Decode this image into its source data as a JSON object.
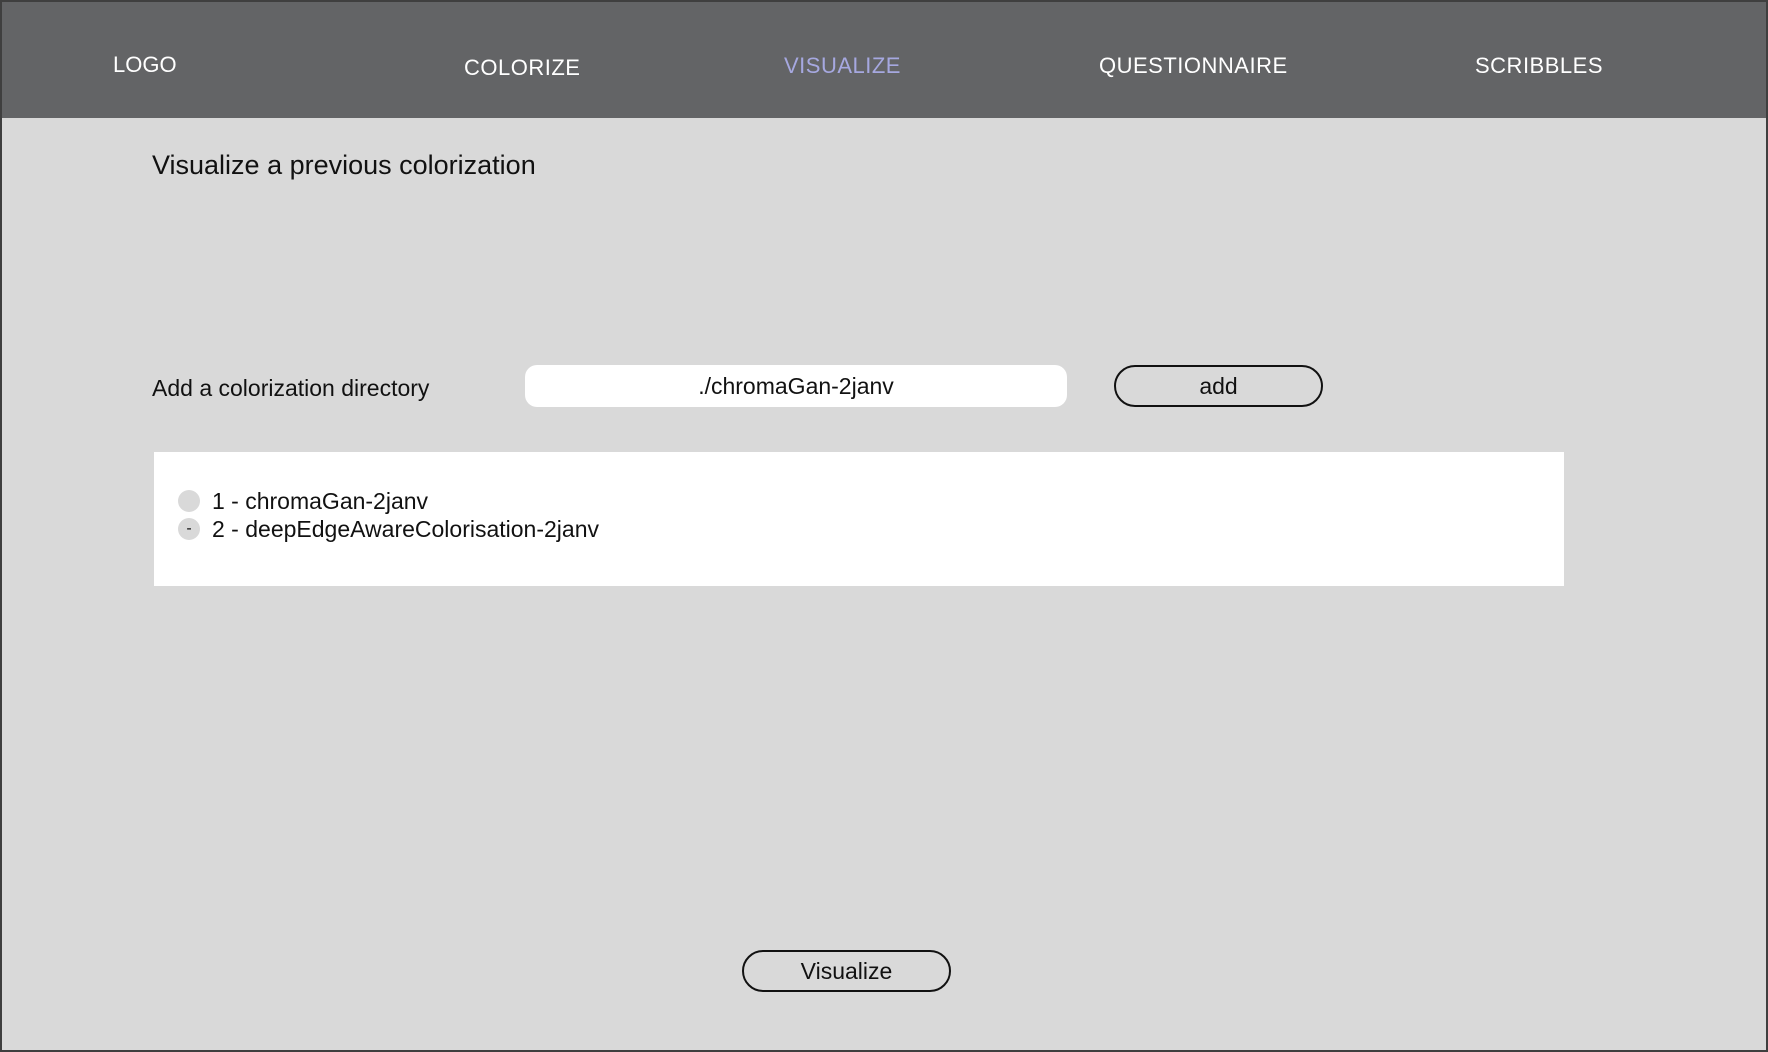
{
  "nav": {
    "logo": "LOGO",
    "items": [
      {
        "label": "COLORIZE",
        "active": false
      },
      {
        "label": "VISUALIZE",
        "active": true
      },
      {
        "label": "QUESTIONNAIRE",
        "active": false
      },
      {
        "label": "SCRIBBLES",
        "active": false
      }
    ],
    "active_color": "#a6a8e0",
    "bar_color": "#636466"
  },
  "page": {
    "title": "Visualize a previous colorization",
    "background": "#d9d9d9"
  },
  "directory": {
    "label": "Add a colorization directory",
    "value": "./chromaGan-2janv",
    "add_label": "add"
  },
  "list": {
    "items": [
      {
        "label": "1 - chromaGan-2janv",
        "marker": ""
      },
      {
        "label": "2 - deepEdgeAwareColorisation-2janv",
        "marker": "-"
      }
    ]
  },
  "footer": {
    "visualize_label": "Visualize"
  }
}
